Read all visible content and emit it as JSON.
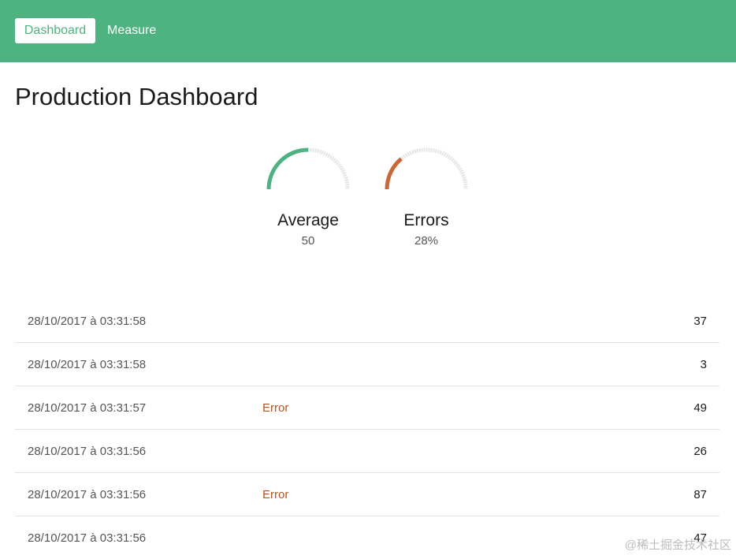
{
  "colors": {
    "brand": "#4db380",
    "error": "#cc6633",
    "track": "#e6e6e6"
  },
  "nav": {
    "tabs": [
      {
        "label": "Dashboard",
        "active": true
      },
      {
        "label": "Measure",
        "active": false
      }
    ]
  },
  "page": {
    "title": "Production Dashboard"
  },
  "gauges": [
    {
      "label": "Average",
      "display": "50",
      "fraction": 0.5,
      "color": "#4db380"
    },
    {
      "label": "Errors",
      "display": "28%",
      "fraction": 0.28,
      "color": "#cc6633"
    }
  ],
  "table": {
    "rows": [
      {
        "date": "28/10/2017 à 03:31:58",
        "status": "",
        "value": "37"
      },
      {
        "date": "28/10/2017 à 03:31:58",
        "status": "",
        "value": "3"
      },
      {
        "date": "28/10/2017 à 03:31:57",
        "status": "Error",
        "value": "49"
      },
      {
        "date": "28/10/2017 à 03:31:56",
        "status": "",
        "value": "26"
      },
      {
        "date": "28/10/2017 à 03:31:56",
        "status": "Error",
        "value": "87"
      },
      {
        "date": "28/10/2017 à 03:31:56",
        "status": "",
        "value": "47"
      }
    ]
  },
  "watermark": "@稀土掘金技术社区"
}
